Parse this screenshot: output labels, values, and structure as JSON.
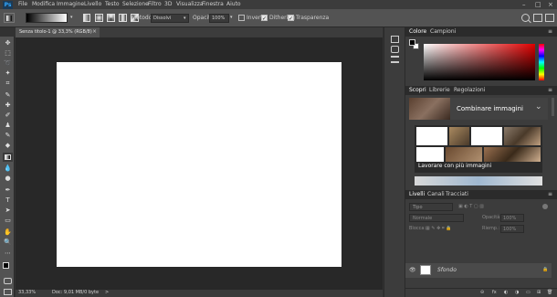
{
  "menubar": {
    "app_icon": "Ps",
    "items": [
      "File",
      "Modifica",
      "Immagine",
      "Livello",
      "Testo",
      "Selezione",
      "Filtro",
      "3D",
      "Visualizza",
      "Finestra",
      "Aiuto"
    ],
    "controls": [
      "–",
      "□",
      "×"
    ]
  },
  "options": {
    "metodo_label": "Metodo:",
    "metodo_value": "Dissolvi",
    "opacita_label": "Opacità:",
    "opacita_value": "100%",
    "inverti_label": "Inverti",
    "dithering_label": "Dithering",
    "trasparenza_label": "Trasparenza"
  },
  "document": {
    "tab_title": "Senza titolo-1 @ 33,3% (RGB/8)",
    "tab_close": "×",
    "zoom": "33,33%",
    "doc_info": "Doc: 9,01 MB/0 byte",
    "status_arrow": ">"
  },
  "color_panel": {
    "tabs": [
      "Colore",
      "Campioni"
    ],
    "active_tab": "Colore",
    "menu": "≡"
  },
  "learn_panel": {
    "tabs": [
      "Scopri",
      "Librerie",
      "Regolazioni"
    ],
    "active_tab": "Scopri",
    "card1_title": "Combinare immagini",
    "card1_chevron": "⌄",
    "card2_title": "Lavorare con più immagini"
  },
  "layers_panel": {
    "tabs": [
      "Livelli",
      "Canali",
      "Tracciati"
    ],
    "active_tab": "Livelli",
    "search_placeholder": "Tipo",
    "blend_mode": "Normale",
    "opacity_label": "Opacità:",
    "opacity_value": "100%",
    "lock_label": "Blocca:",
    "fill_label": "Riemp.:",
    "fill_value": "100%",
    "layer_name": "Sfondo",
    "visibility_icon": "👁",
    "bottom_icons": [
      "⊝",
      "fx",
      "◐",
      "◑",
      "▭",
      "⊞",
      "🗑"
    ]
  },
  "colors": {
    "accent": "#31a8ff",
    "foreground": "#000000",
    "background": "#ffffff"
  }
}
